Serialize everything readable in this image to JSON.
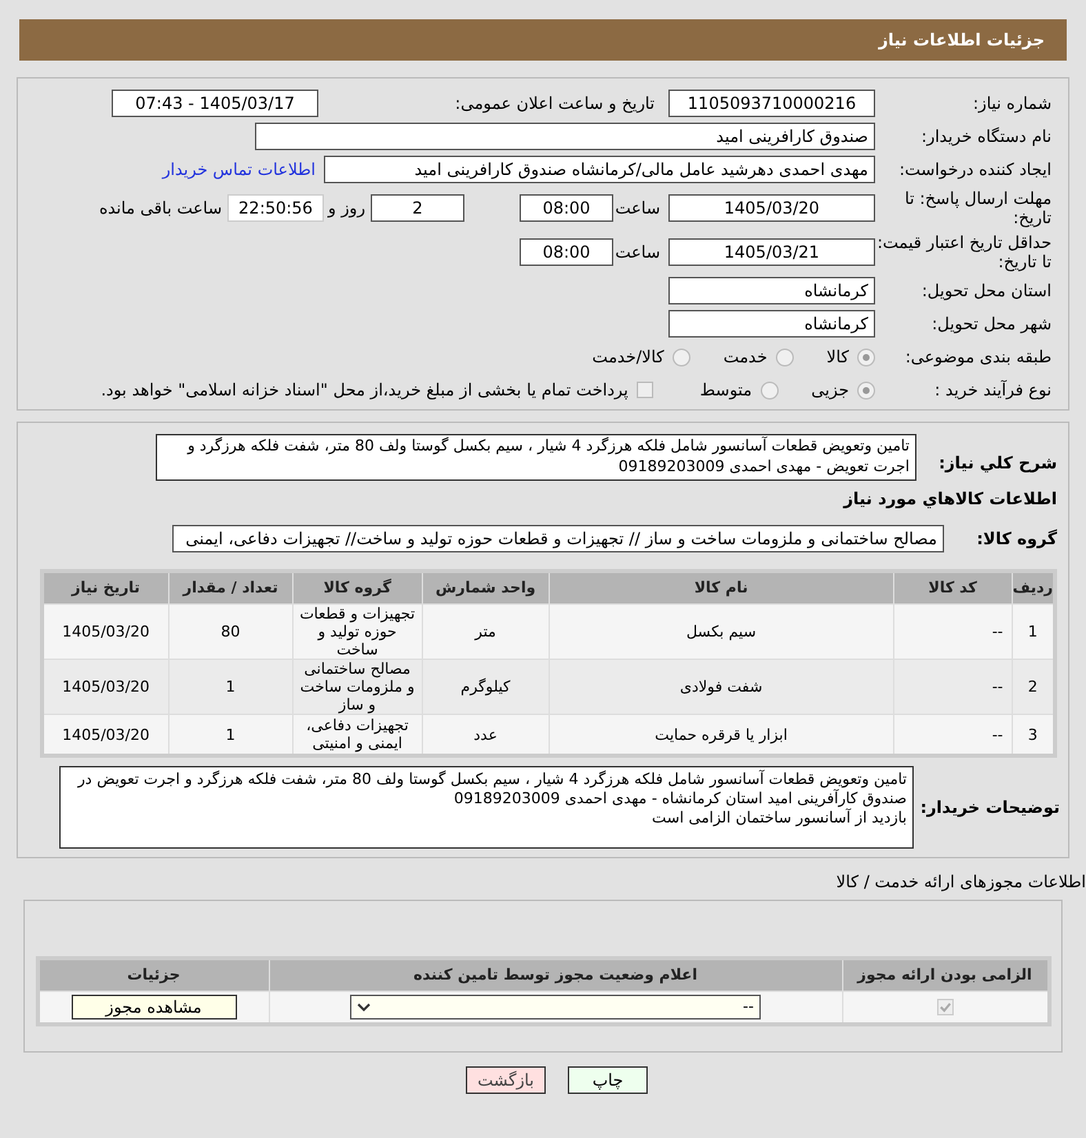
{
  "header": {
    "title": "جزئیات اطلاعات نیاز"
  },
  "need_number": {
    "label": "شماره نیاز:",
    "value": "1105093710000216"
  },
  "announce": {
    "label": "تاریخ و ساعت اعلان عمومی:",
    "value": "1405/03/17 - 07:43"
  },
  "buyer_org": {
    "label": "نام دستگاه خریدار:",
    "value": "صندوق کارافرینی امید"
  },
  "creator": {
    "label": "ایجاد کننده درخواست:",
    "value": "مهدی احمدی دهرشید عامل مالی/کرمانشاه صندوق کارافرینی امید",
    "link": "اطلاعات تماس خریدار"
  },
  "deadline": {
    "label": "مهلت ارسال پاسخ: تا تاریخ:",
    "date": "1405/03/20",
    "time_label": "ساعت",
    "time": "08:00",
    "days": "2",
    "days_label": "روز و",
    "remaining": "22:50:56",
    "remaining_label": "ساعت باقی مانده"
  },
  "validity": {
    "label": "حداقل تاریخ اعتبار قیمت: تا تاریخ:",
    "date": "1405/03/21",
    "time_label": "ساعت",
    "time": "08:00"
  },
  "province": {
    "label": "استان محل تحویل:",
    "value": "کرمانشاه"
  },
  "city": {
    "label": "شهر محل تحویل:",
    "value": "کرمانشاه"
  },
  "category": {
    "label": "طبقه بندی موضوعی:",
    "options": [
      {
        "label": "کالا",
        "selected": true
      },
      {
        "label": "خدمت",
        "selected": false
      },
      {
        "label": "کالا/خدمت",
        "selected": false
      }
    ]
  },
  "process": {
    "label": "نوع فرآیند خرید :",
    "options": [
      {
        "label": "جزیی",
        "selected": true
      },
      {
        "label": "متوسط",
        "selected": false
      }
    ],
    "treasury": {
      "label": "پرداخت تمام یا بخشی از مبلغ خرید،از محل \"اسناد خزانه اسلامی\" خواهد بود.",
      "checked": false
    }
  },
  "description": {
    "label": "شرح کلي نياز:",
    "value": "تامین  وتعویض قطعات آسانسور شامل فلکه هرزگرد 4 شیار ، سیم بکسل گوستا ولف 80 متر، شفت فلکه هرزگرد و اجرت تعویض  - مهدی احمدی 09189203009"
  },
  "goods_heading": "اطلاعات كالاهاي مورد نياز",
  "goods_group": {
    "label": "گروه کالا:",
    "value": "مصالح ساختمانی و ملزومات ساخت و ساز // تجهیزات و قطعات حوزه تولید و ساخت// تجهیزات دفاعی، ایمنی"
  },
  "table": {
    "columns": [
      "ردیف",
      "کد کالا",
      "نام کالا",
      "واحد شمارش",
      "گروه کالا",
      "تعداد / مقدار",
      "تاریخ نیاز"
    ],
    "rows": [
      [
        "1",
        "--",
        "سیم بکسل",
        "متر",
        "تجهیزات و قطعات حوزه تولید و ساخت",
        "80",
        "1405/03/20"
      ],
      [
        "2",
        "--",
        "شفت فولادی",
        "کیلوگرم",
        "مصالح ساختمانی و ملزومات ساخت و ساز",
        "1",
        "1405/03/20"
      ],
      [
        "3",
        "--",
        "ابزار یا قرقره حمایت",
        "عدد",
        "تجهیزات دفاعی، ایمنی و امنیتی",
        "1",
        "1405/03/20"
      ]
    ]
  },
  "buyer_notes": {
    "label": "توضیحات خریدار:",
    "lines": [
      "تامین  وتعویض قطعات آسانسور شامل فلکه هرزگرد 4 شیار ، سیم بکسل گوستا ولف 80 متر، شفت فلکه هرزگرد و اجرت تعویض در صندوق کارآفرینی امید استان کرمانشاه - مهدی احمدی 09189203009",
      "بازدید از آسانسور ساختمان الزامی است"
    ]
  },
  "licenses": {
    "heading": "اطلاعات مجوزهای ارائه خدمت / کالا",
    "columns": [
      "الزامی بودن ارائه مجوز",
      "اعلام وضعیت مجوز توسط تامین کننده",
      "جزئیات"
    ],
    "rows": [
      {
        "required": true,
        "status": "--",
        "details_button": "مشاهده مجوز"
      }
    ]
  },
  "buttons": [
    {
      "kind": "print",
      "label": "چاپ"
    },
    {
      "kind": "back",
      "label": "بازگشت"
    }
  ]
}
